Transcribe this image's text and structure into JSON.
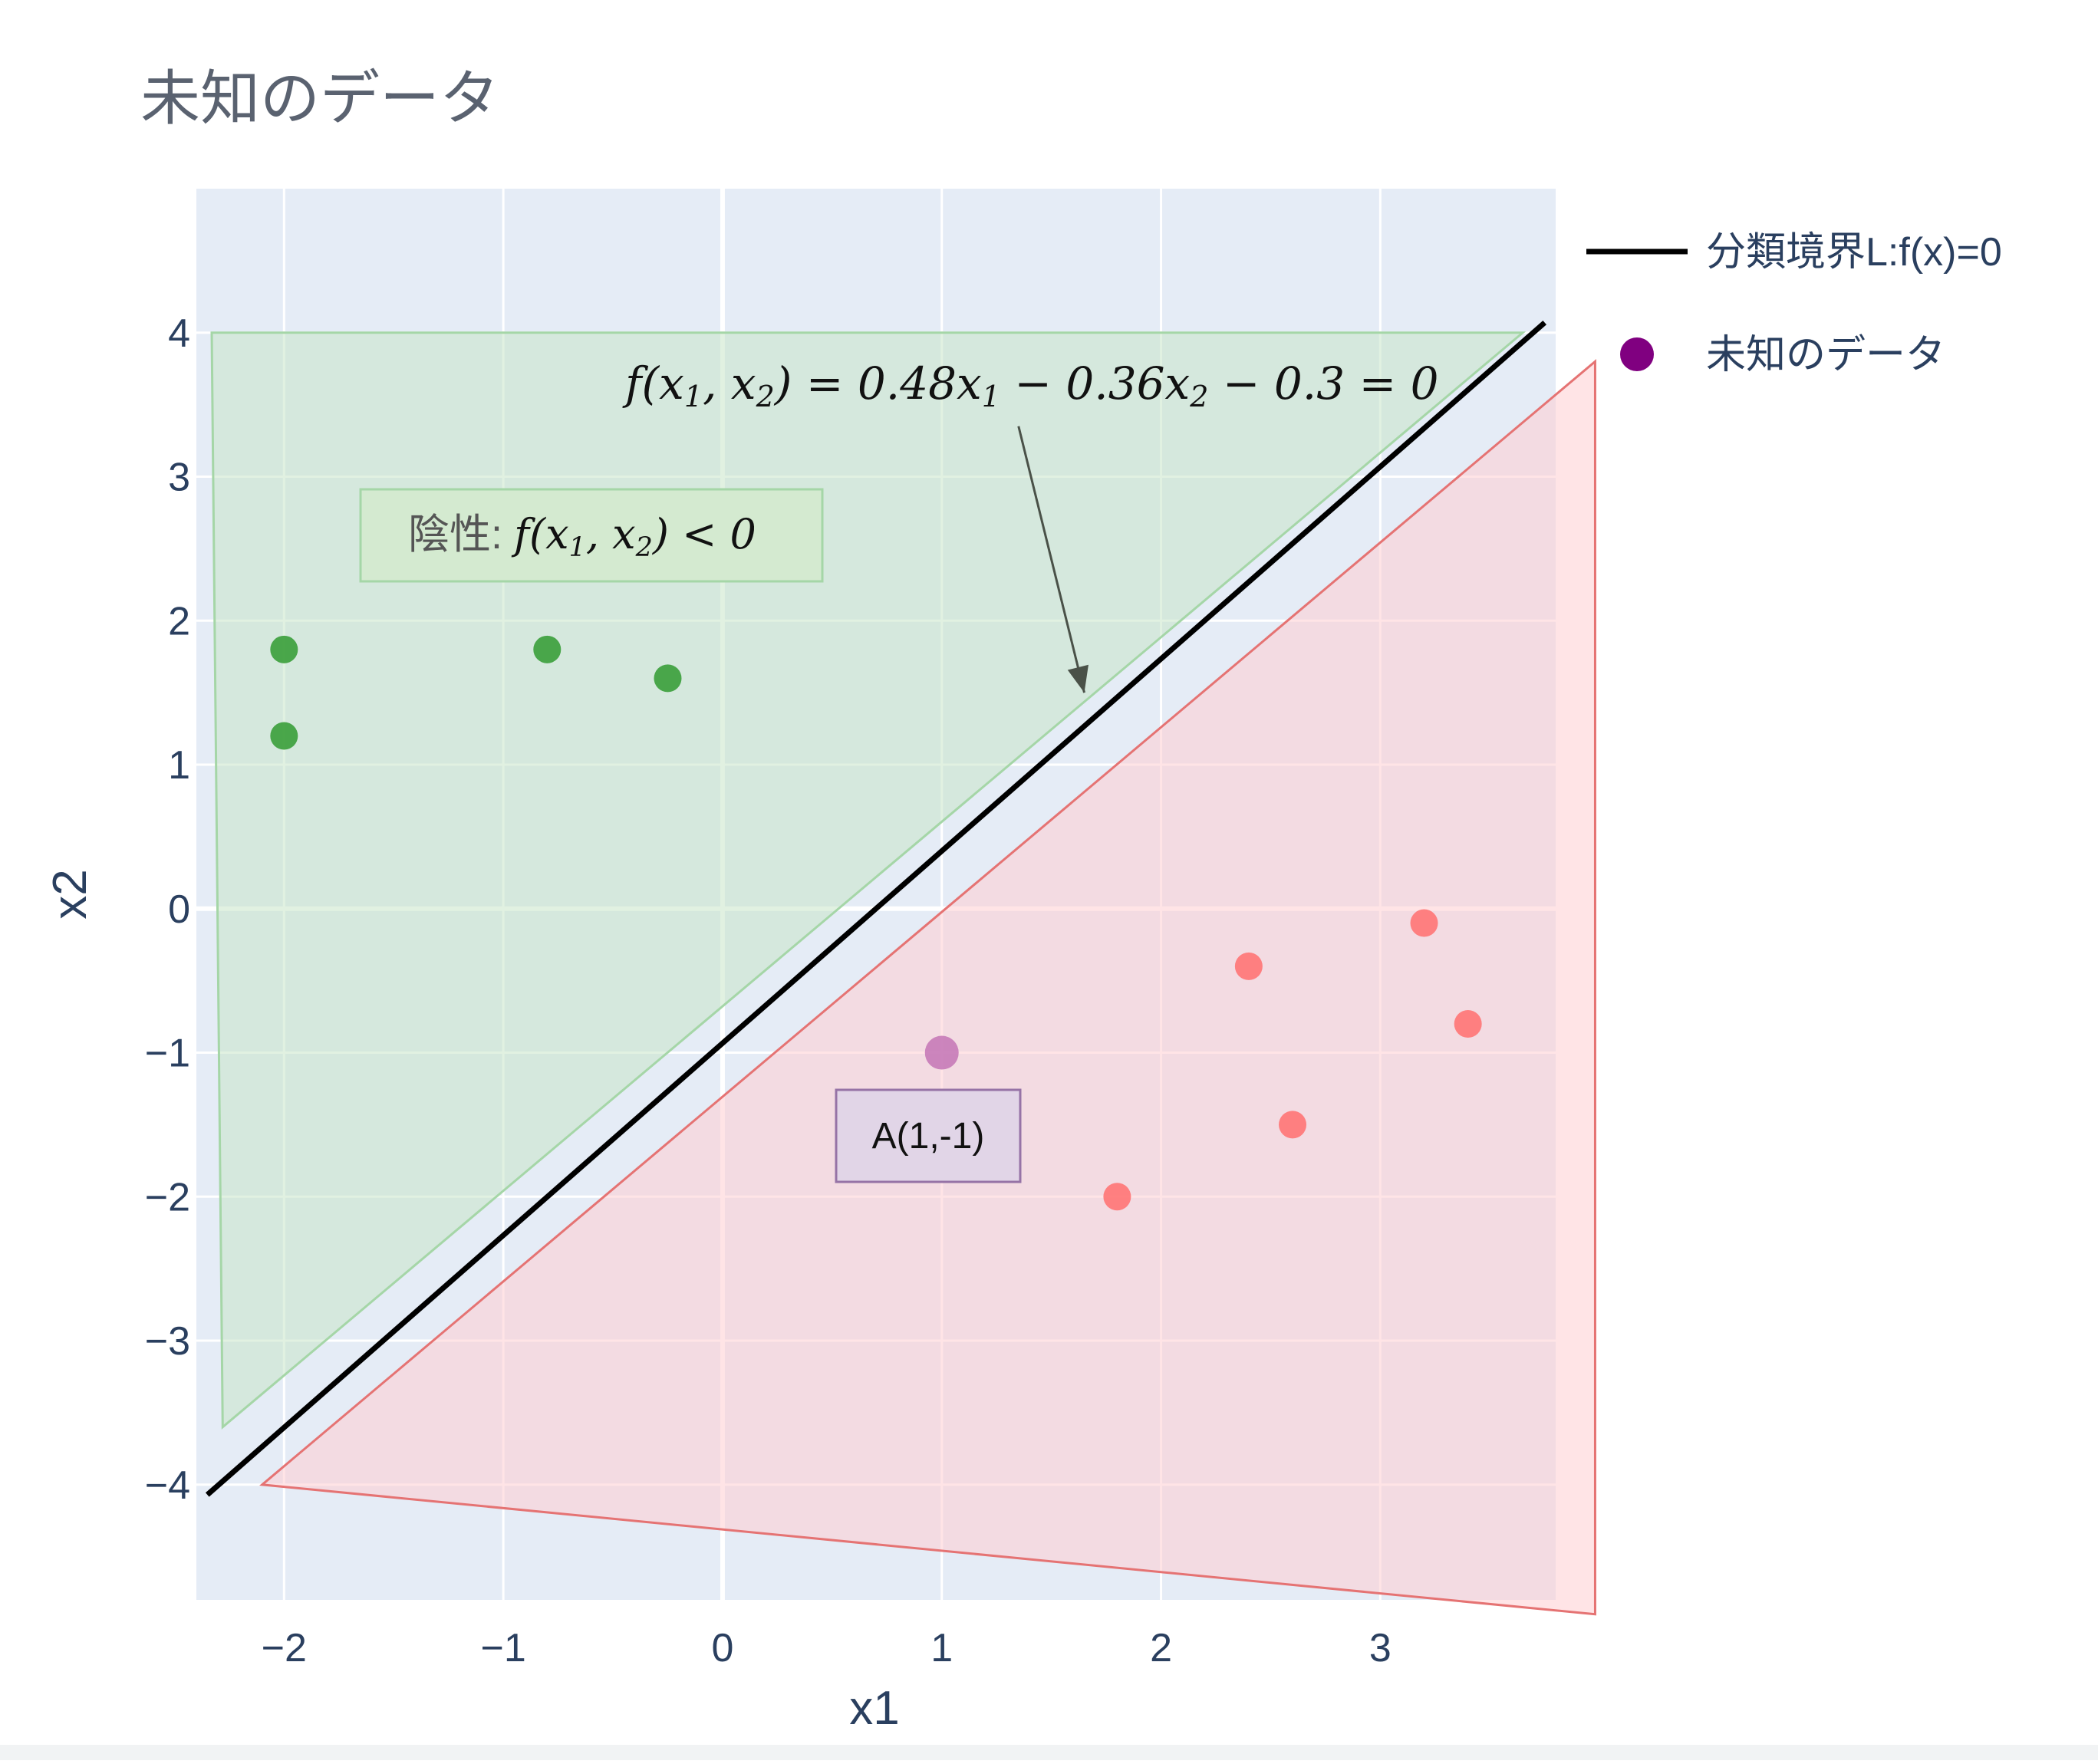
{
  "chart_data": {
    "type": "scatter",
    "title": "未知のデータ",
    "xlabel": "x1",
    "ylabel": "x2",
    "xlim": [
      -2.4,
      3.8
    ],
    "ylim": [
      -4.8,
      5
    ],
    "x_ticks": [
      -2,
      -1,
      0,
      1,
      2,
      3
    ],
    "y_ticks": [
      -4,
      -3,
      -2,
      -1,
      0,
      1,
      2,
      3,
      4
    ],
    "x_tick_labels": [
      "−2",
      "−1",
      "0",
      "1",
      "2",
      "3"
    ],
    "y_tick_labels": [
      "−4",
      "−3",
      "−2",
      "−1",
      "0",
      "1",
      "2",
      "3",
      "4"
    ],
    "grid": true,
    "legend_position": "top-right",
    "series": [
      {
        "name": "分類境界L:f(x)=0",
        "mode": "line",
        "color": "#000000",
        "x": [
          -2.35,
          3.75
        ],
        "y": [
          -4.07,
          4.07
        ]
      },
      {
        "name": "未知のデータ",
        "mode": "markers",
        "color": "#800080",
        "x": [
          1
        ],
        "y": [
          -1
        ]
      }
    ],
    "unlabeled_series": [
      {
        "color": "#3a9e3a",
        "x": [
          -2,
          -2,
          -0.8,
          -0.25
        ],
        "y": [
          1.8,
          1.2,
          1.8,
          1.6
        ]
      },
      {
        "color": "#ff6f6f",
        "x": [
          2.4,
          2.6,
          1.8,
          3.2,
          3.4
        ],
        "y": [
          -0.4,
          -1.5,
          -2,
          -0.1,
          -0.8
        ]
      }
    ],
    "regions": [
      {
        "fill": "#c8e6c9",
        "stroke": "#a5d6a7",
        "x": [
          -2.33,
          3.65,
          -2.28
        ],
        "y": [
          4,
          4,
          -3.6
        ]
      },
      {
        "fill": "#ffcdd2",
        "stroke": "#e57373",
        "x": [
          -2.1,
          3.98,
          3.98
        ],
        "y": [
          -4,
          3.8,
          -4.9
        ]
      }
    ],
    "annotations": [
      {
        "id": "equation",
        "text_parts": [
          "f(x",
          "1",
          ", x",
          "2",
          ") = 0.48x",
          "1",
          " − 0.36x",
          "2",
          " − 0.3 = 0"
        ],
        "subscript_indices": [
          1,
          3,
          5,
          7
        ],
        "arrow_to_x": 1.65,
        "arrow_to_y": 1.5,
        "arrow_from_x": 1.35,
        "arrow_from_y": 3.35
      },
      {
        "id": "negative",
        "prefix": "陰性: ",
        "text_parts": [
          "f(x",
          "1",
          ", x",
          "2",
          ") < 0"
        ],
        "subscript_indices": [
          1,
          3
        ],
        "bg": "#d4ead0",
        "border": "#a5d6a7"
      },
      {
        "id": "point-a",
        "text": "A(1,-1)",
        "bg": "#e1d5e7",
        "border": "#9673a6"
      }
    ]
  }
}
